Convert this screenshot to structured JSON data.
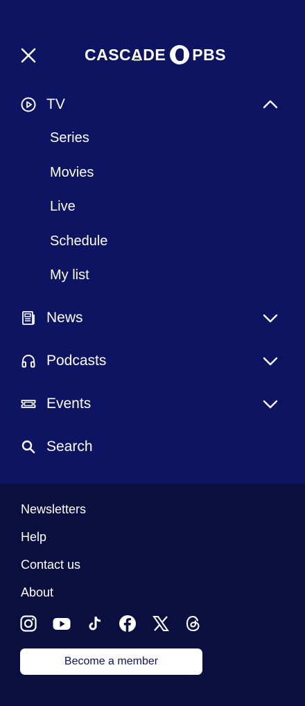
{
  "header": {
    "logo_text_left": "CASC",
    "logo_text_a": "A",
    "logo_text_mid": "DE",
    "logo_text_right": "PBS"
  },
  "nav": {
    "tv": {
      "label": "TV",
      "icon": "play-circle-icon",
      "expanded": true,
      "sub_items": [
        "Series",
        "Movies",
        "Live",
        "Schedule",
        "My list"
      ]
    },
    "news": {
      "label": "News",
      "icon": "newspaper-icon"
    },
    "podcasts": {
      "label": "Podcasts",
      "icon": "headphones-icon"
    },
    "events": {
      "label": "Events",
      "icon": "ticket-icon"
    },
    "search": {
      "label": "Search",
      "icon": "search-icon"
    }
  },
  "footer": {
    "links": [
      "Newsletters",
      "Help",
      "Contact us",
      "About"
    ],
    "social": [
      "instagram-icon",
      "youtube-icon",
      "tiktok-icon",
      "facebook-icon",
      "x-icon",
      "threads-icon"
    ],
    "member_button": "Become a member"
  },
  "colors": {
    "menu_bg": "#0d1462",
    "footer_bg": "#0a0f40",
    "accent": "#9cd046",
    "text": "#ffffff"
  }
}
